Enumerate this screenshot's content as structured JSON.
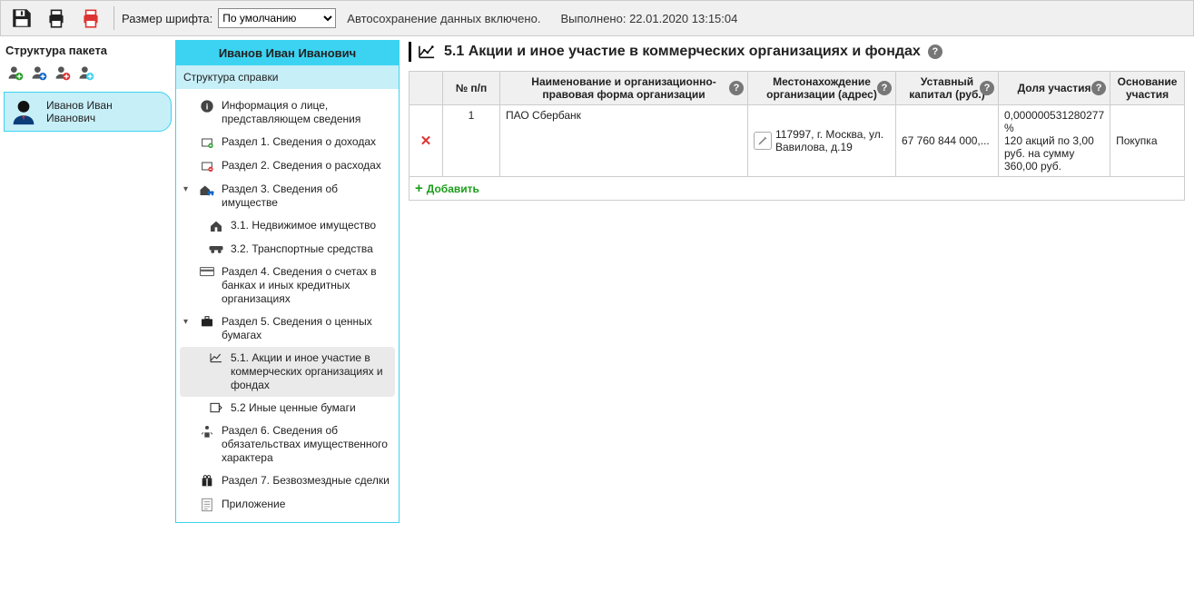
{
  "toolbar": {
    "font_label": "Размер шрифта:",
    "font_value": "По умолчанию",
    "autosave": "Автосохранение данных включено.",
    "done_prefix": "Выполнено:",
    "done_ts": "22.01.2020 13:15:04"
  },
  "package": {
    "title": "Структура пакета",
    "person": "Иванов Иван Иванович"
  },
  "ref": {
    "person": "Иванов Иван Иванович",
    "subtitle": "Структура справки",
    "items": [
      {
        "label": "Информация о лице, представляющем сведения"
      },
      {
        "label": "Раздел 1. Сведения о доходах"
      },
      {
        "label": "Раздел 2. Сведения о расходах"
      },
      {
        "label": "Раздел 3. Сведения об имуществе"
      },
      {
        "label": "3.1. Недвижимое имущество"
      },
      {
        "label": "3.2. Транспортные средства"
      },
      {
        "label": "Раздел 4. Сведения о счетах в банках и иных кредитных организациях"
      },
      {
        "label": "Раздел 5. Сведения о ценных бумагах"
      },
      {
        "label": "5.1. Акции и иное участие в коммерческих организациях и фондах"
      },
      {
        "label": "5.2 Иные ценные бумаги"
      },
      {
        "label": "Раздел 6. Сведения об обязательствах имущественного характера"
      },
      {
        "label": "Раздел 7. Безвозмездные сделки"
      },
      {
        "label": "Приложение"
      }
    ]
  },
  "section": {
    "title": "5.1 Акции и иное участие в коммерческих организациях и фондах"
  },
  "table": {
    "headers": {
      "num": "№ п/п",
      "name": "Наименование и организационно-правовая форма организации",
      "loc": "Местонахождение организации (адрес)",
      "cap": "Уставный капитал (руб.)",
      "share": "Доля участия",
      "basis": "Основание участия"
    },
    "row": {
      "num": "1",
      "name": "ПАО Сбербанк",
      "loc": "117997, г. Москва, ул. Вавилова, д.19",
      "cap": "67 760 844 000,...",
      "share": "0,000000531280277 %\n120 акций по 3,00  руб. на сумму 360,00 руб.",
      "basis": "Покупка"
    },
    "add": "Добавить"
  }
}
